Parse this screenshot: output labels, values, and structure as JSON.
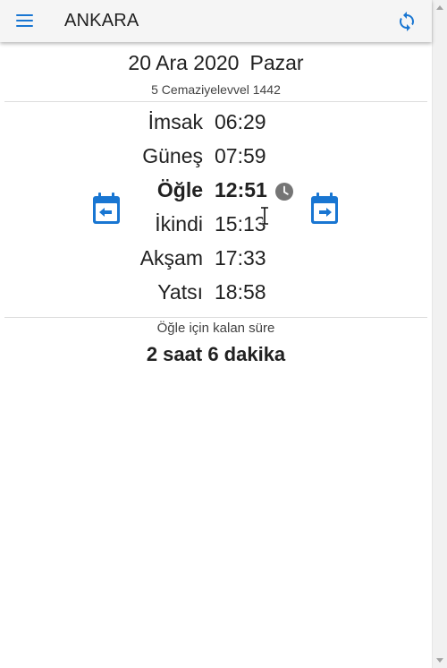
{
  "toolbar": {
    "title": "ANKARA",
    "menu_icon": "menu-icon",
    "refresh_icon": "refresh-icon"
  },
  "date": {
    "gregorian": "20 Ara 2020",
    "weekday": "Pazar",
    "hijri": "5 Cemaziyelevvel 1442"
  },
  "prayers": [
    {
      "name": "İmsak",
      "time": "06:29",
      "active": false
    },
    {
      "name": "Güneş",
      "time": "07:59",
      "active": false
    },
    {
      "name": "Öğle",
      "time": "12:51",
      "active": true
    },
    {
      "name": "İkindi",
      "time": "15:13",
      "active": false
    },
    {
      "name": "Akşam",
      "time": "17:33",
      "active": false
    },
    {
      "name": "Yatsı",
      "time": "18:58",
      "active": false
    }
  ],
  "navigation": {
    "prev_icon": "calendar-previous-day-icon",
    "next_icon": "calendar-next-day-icon"
  },
  "remaining": {
    "label": "Öğle için kalan süre",
    "value": "2 saat 6 dakika"
  },
  "colors": {
    "accent": "#1976d2",
    "toolbar_bg": "#f5f5f5",
    "clock_icon": "#757575"
  }
}
